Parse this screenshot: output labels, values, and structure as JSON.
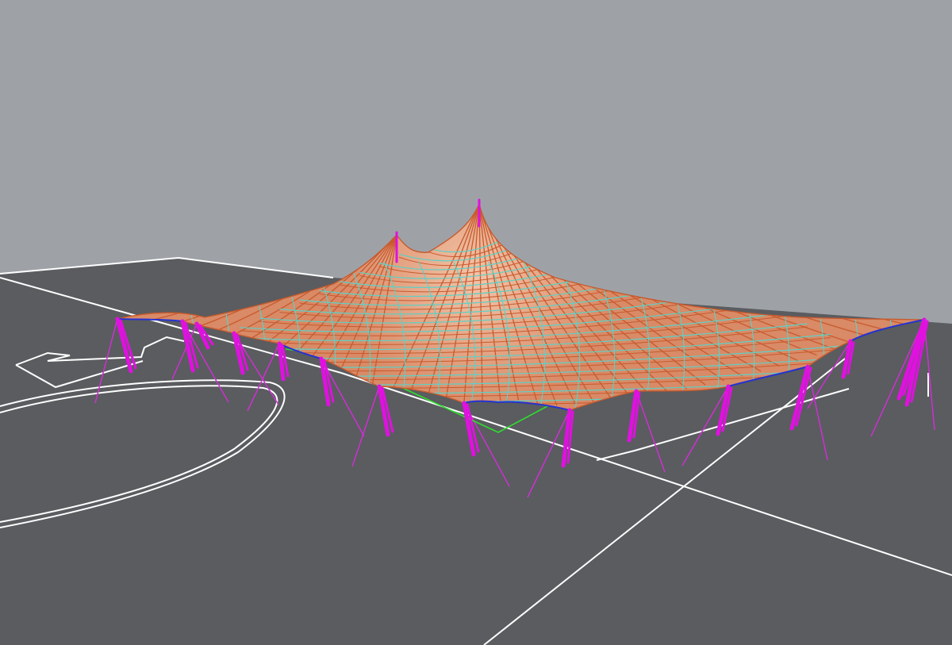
{
  "viewport": {
    "view": "perspective",
    "colors": {
      "sky": "#9ea2a7",
      "ground": "#5a5c5f",
      "court_lines": "#ffffff",
      "membrane_fill": "#d98a66",
      "membrane_edge": "#c85a2e",
      "warp_threads": "#c85a2e",
      "weft_threads": "#5ed0c6",
      "edge_cables": "#2533d0",
      "masts": "#e011e0",
      "guy_cables": "#cf2fd4",
      "selection_outline": "#2ee02e"
    },
    "objects": [
      {
        "name": "tensile-membrane-roof",
        "peaks": 2
      },
      {
        "name": "perimeter-masts"
      },
      {
        "name": "guy-cables"
      },
      {
        "name": "edge-cables"
      },
      {
        "name": "court-markings"
      },
      {
        "name": "selection-outline"
      }
    ]
  }
}
